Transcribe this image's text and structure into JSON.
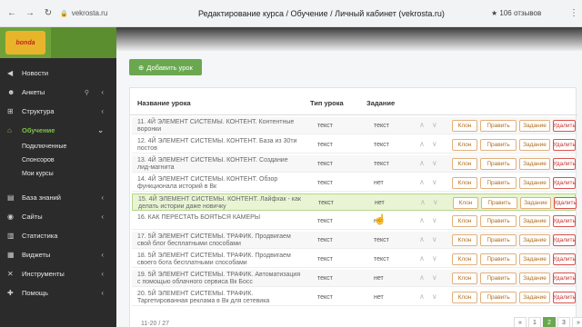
{
  "browser": {
    "url": "vekrosta.ru",
    "title": "Редактирование курса / Обучение / Личный кабинет (vekrosta.ru)",
    "reviews": "106 отзывов"
  },
  "sidebar": {
    "logo_text": "bonda",
    "items": [
      {
        "label": "Новости",
        "icon": "megaphone-icon"
      },
      {
        "label": "Анкеты",
        "icon": "person-icon"
      },
      {
        "label": "Структура",
        "icon": "sitemap-icon"
      },
      {
        "label": "Обучение",
        "icon": "graduation-icon"
      },
      {
        "label": "База знаний",
        "icon": "book-icon"
      },
      {
        "label": "Сайты",
        "icon": "globe-icon"
      },
      {
        "label": "Статистика",
        "icon": "chart-icon"
      },
      {
        "label": "Виджеты",
        "icon": "widget-icon"
      },
      {
        "label": "Инструменты",
        "icon": "tools-icon"
      },
      {
        "label": "Помощь",
        "icon": "help-icon"
      }
    ],
    "sub_items": [
      "Подключенные",
      "Спонсоров",
      "Мои курсы"
    ]
  },
  "main": {
    "add_button": "Добавить урок",
    "columns": {
      "name": "Название урока",
      "type": "Тип урока",
      "task": "Задание"
    },
    "buttons": {
      "klon": "Клон",
      "edit": "Править",
      "task": "Задание",
      "del": "Удалить"
    },
    "rows": [
      {
        "name": "11. 4Й ЭЛЕМЕНТ СИСТЕМЫ. КОНТЕНТ. Контентные воронки",
        "type": "текст",
        "task": "текст"
      },
      {
        "name": "12. 4Й ЭЛЕМЕНТ СИСТЕМЫ. КОНТЕНТ. База из 30ти постов",
        "type": "текст",
        "task": "текст"
      },
      {
        "name": "13. 4Й ЭЛЕМЕНТ СИСТЕМЫ. КОНТЕНТ. Создание лид-магнита",
        "type": "текст",
        "task": "текст"
      },
      {
        "name": "14. 4Й ЭЛЕМЕНТ СИСТЕМЫ. КОНТЕНТ. Обзор функционала историй в Вк",
        "type": "текст",
        "task": "нет"
      },
      {
        "name": "15. 4Й ЭЛЕМЕНТ СИСТЕМЫ. КОНТЕНТ. Лайфхак - как делать истории даже новичку",
        "type": "текст",
        "task": "нет"
      },
      {
        "name": "16. КАК ПЕРЕСТАТЬ БОЯТЬСЯ КАМЕРЫ",
        "type": "текст",
        "task": "нет"
      },
      {
        "name": "17. 5Й ЭЛЕМЕНТ СИСТЕМЫ. ТРАФИК. Продвигаем свой блог бесплатными способами",
        "type": "текст",
        "task": "текст"
      },
      {
        "name": "18. 5Й ЭЛЕМЕНТ СИСТЕМЫ. ТРАФИК. Продвигаем своего бота бесплатными способами",
        "type": "текст",
        "task": "текст"
      },
      {
        "name": "19. 5Й ЭЛЕМЕНТ СИСТЕМЫ. ТРАФИК. Автоматизация с помощью облачного сервиса Вк Босс",
        "type": "текст",
        "task": "нет"
      },
      {
        "name": "20. 5Й ЭЛЕМЕНТ СИСТЕМЫ. ТРАФИК. Таргетированная реклама в Вк для сетевика",
        "type": "текст",
        "task": "нет"
      }
    ],
    "footer": "11-20 / 27",
    "pager": [
      "«",
      "1",
      "2",
      "3",
      "»"
    ],
    "current_page": "2"
  }
}
